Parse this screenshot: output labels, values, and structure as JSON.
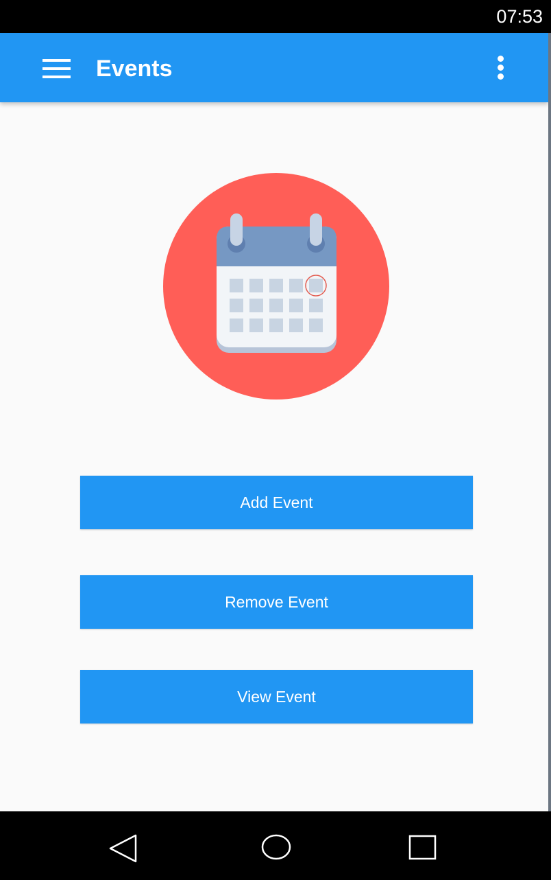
{
  "status_bar": {
    "time": "07:53"
  },
  "app_bar": {
    "title": "Events",
    "navigation_icon": "menu-icon",
    "overflow_icon": "more-vert-icon"
  },
  "hero": {
    "icon": "calendar-icon"
  },
  "actions": [
    {
      "label": "Add Event"
    },
    {
      "label": "Remove Event"
    },
    {
      "label": "View Event"
    }
  ],
  "navigation_bar": {
    "back_icon": "back-icon",
    "home_icon": "home-icon",
    "recents_icon": "recents-icon"
  },
  "colors": {
    "primary": "#2196f3",
    "hero_circle": "#ff5e57",
    "calendar_header": "#7698c3",
    "calendar_cells": "#c8d4e2",
    "selected_outline": "#e35b4f"
  }
}
